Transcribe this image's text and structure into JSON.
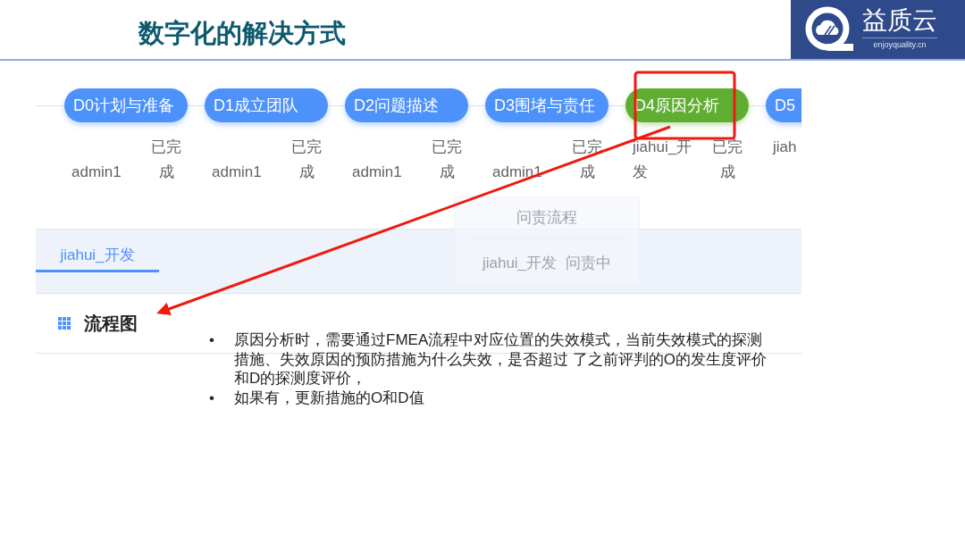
{
  "title": "数字化的解决方式",
  "logo": {
    "name": "益质云",
    "url": "enjoyquality.cn"
  },
  "steps": [
    {
      "label": "D0计划与准备",
      "owner": "admin1",
      "status": "已完成",
      "selected": false
    },
    {
      "label": "D1成立团队",
      "owner": "admin1",
      "status": "已完成",
      "selected": false
    },
    {
      "label": "D2问题描述",
      "owner": "admin1",
      "status": "已完成",
      "selected": false
    },
    {
      "label": "D3围堵与责任",
      "owner": "admin1",
      "status": "已完成",
      "selected": false
    },
    {
      "label": "D4原因分析",
      "owner": "jiahui_开发",
      "status": "已完成",
      "selected": true
    },
    {
      "label": "D5",
      "owner": "jiah",
      "selected": false
    }
  ],
  "tooltip": {
    "title": "问责流程",
    "owner": "jiahui_开发",
    "status": "问责中"
  },
  "tabs": [
    {
      "label": "jiahui_开发",
      "selected": true
    }
  ],
  "section": {
    "title": "流程图"
  },
  "bullets": [
    {
      "marker": "•",
      "text": "原因分析时，需要通过FMEA流程中对应位置的失效模式，当前失效模式的探测措施、失效原因的预防措施为什么失效，是否超过 了之前评判的O的发生度评价和D的探测度评价，"
    },
    {
      "marker": "•",
      "text": "如果有，更新措施的O和D值"
    }
  ]
}
